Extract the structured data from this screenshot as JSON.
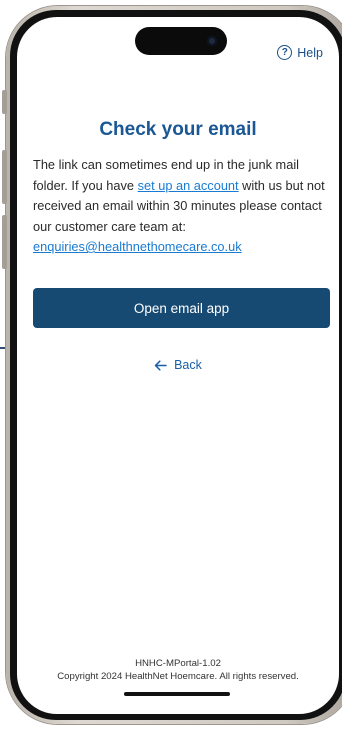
{
  "header": {
    "help_label": "Help",
    "help_icon": "question-circle-icon"
  },
  "main": {
    "title": "Check your email",
    "body_part1": "The link can sometimes end up in the junk mail folder. If you have ",
    "setup_link": "set up an account",
    "body_part2": " with us but not received an email within 30 minutes please contact our customer care team at: ",
    "email_link": "enquiries@healthnethomecare.co.uk",
    "open_email_label": "Open email app",
    "back_label": "Back",
    "back_icon": "arrow-left-icon"
  },
  "footer": {
    "version": "HNHC-MPortal-1.02",
    "copyright": "Copyright 2024 HealthNet Hoemcare. All rights reserved."
  },
  "colors": {
    "title": "#1a5794",
    "button": "#174a72",
    "link": "#1a7bd1",
    "help": "#1a4f86"
  }
}
